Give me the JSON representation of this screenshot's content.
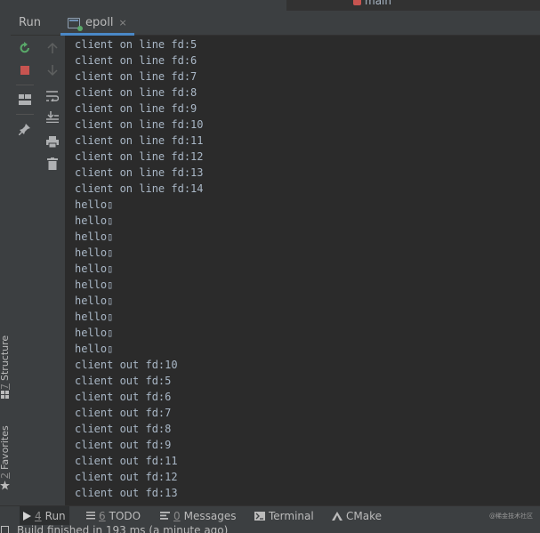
{
  "editor": {
    "tab_label": "main"
  },
  "run_window": {
    "title": "Run",
    "tab": {
      "label": "epoll",
      "close_glyph": "×"
    }
  },
  "side_stripe": {
    "structure": {
      "num": "7",
      "label": "Structure"
    },
    "favorites": {
      "num": "2",
      "label": "Favorites"
    }
  },
  "toolbar_icons": {
    "left": [
      "rerun-icon",
      "stop-icon",
      "layout-icon",
      "pin-icon"
    ],
    "right": [
      "up-arrow-icon",
      "down-arrow-icon",
      "soft-wrap-icon",
      "scroll-to-end-icon",
      "print-icon",
      "trash-icon"
    ]
  },
  "console": {
    "lines": [
      "client on line fd:5",
      "client on line fd:6",
      "client on line fd:7",
      "client on line fd:8",
      "client on line fd:9",
      "client on line fd:10",
      "client on line fd:11",
      "client on line fd:12",
      "client on line fd:13",
      "client on line fd:14",
      "hello▯",
      "hello▯",
      "hello▯",
      "hello▯",
      "hello▯",
      "hello▯",
      "hello▯",
      "hello▯",
      "hello▯",
      "hello▯",
      "client out fd:10",
      "client out fd:5",
      "client out fd:6",
      "client out fd:7",
      "client out fd:8",
      "client out fd:9",
      "client out fd:11",
      "client out fd:12",
      "client out fd:13"
    ]
  },
  "bottom_tabs": [
    {
      "num": "4",
      "label": "Run",
      "icon": "play-icon"
    },
    {
      "num": "6",
      "label": "TODO",
      "icon": "list-icon"
    },
    {
      "num": "0",
      "label": "Messages",
      "icon": "messages-icon"
    },
    {
      "num": "",
      "label": "Terminal",
      "icon": "terminal-icon"
    },
    {
      "num": "",
      "label": "CMake",
      "icon": "cmake-icon"
    }
  ],
  "watermark": "@稀金技术社区",
  "status": {
    "text": "Build finished in 193 ms (a minute ago)"
  },
  "colors": {
    "accent": "#4a88c7",
    "console_text": "#a9b7c6",
    "panel_bg": "#3c3f41",
    "console_bg": "#2b2b2b",
    "run_green": "#59a869",
    "stop_red": "#c75450"
  }
}
